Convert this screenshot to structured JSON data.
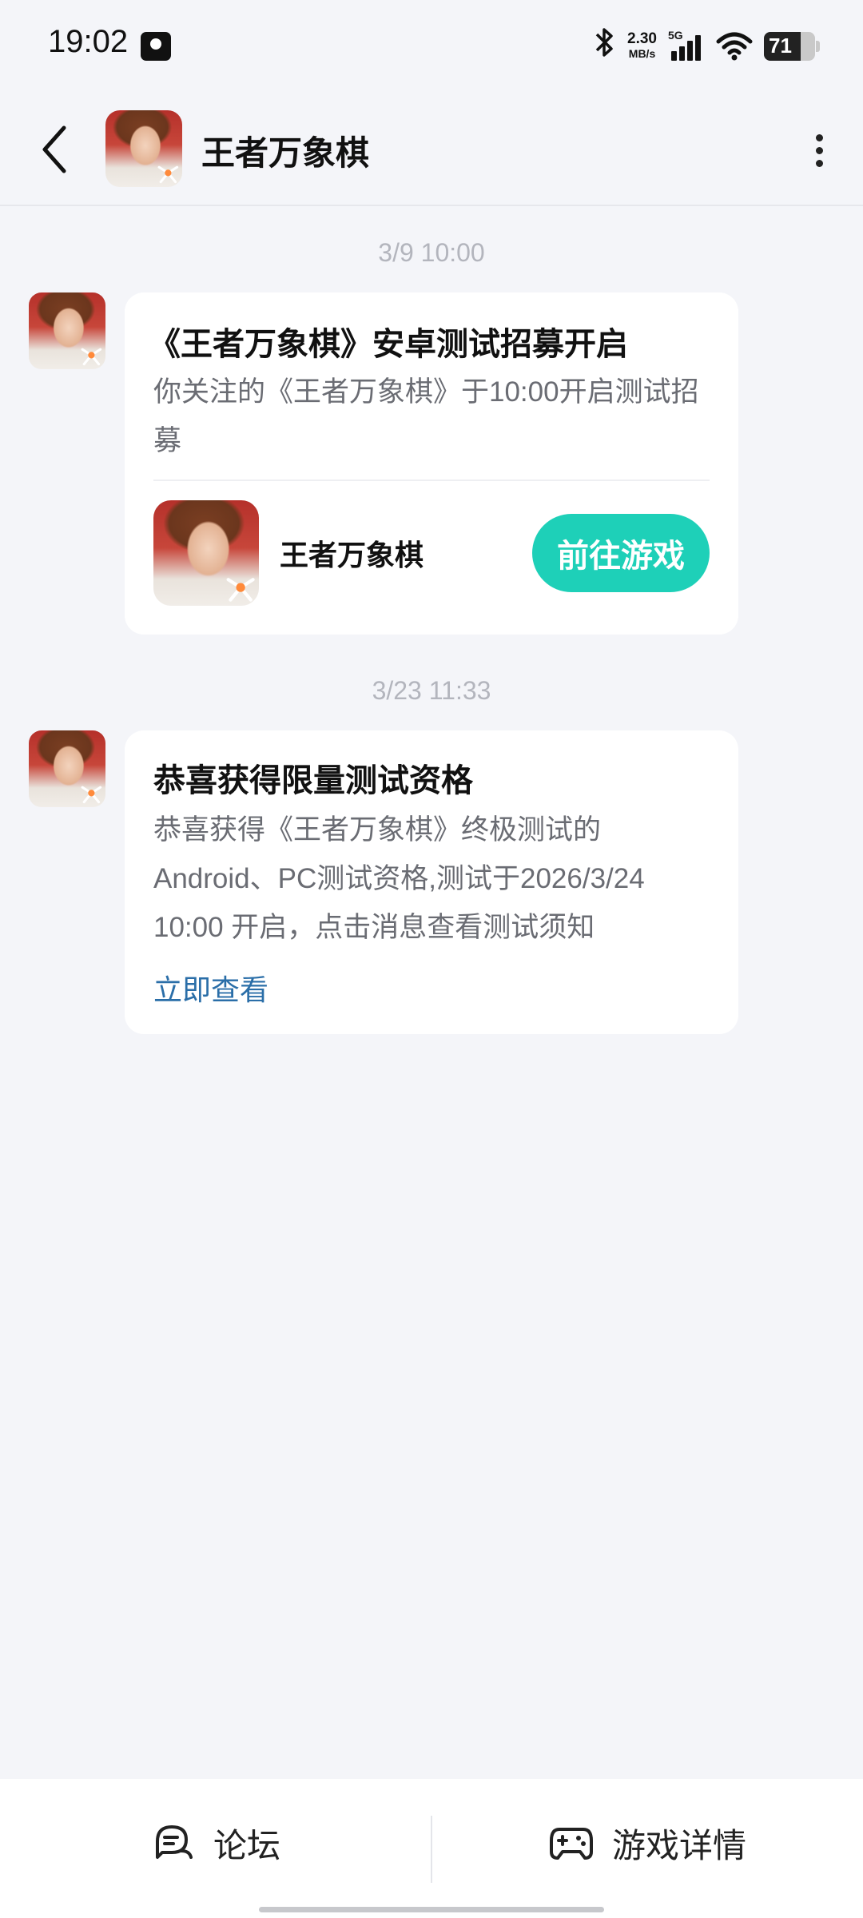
{
  "status_bar": {
    "time": "19:02",
    "net_speed_value": "2.30",
    "net_speed_unit": "MB/s",
    "network_type": "5G",
    "battery_level": "71"
  },
  "header": {
    "title": "王者万象棋",
    "back_icon": "chevron-left-icon",
    "more_icon": "more-vertical-icon"
  },
  "messages": [
    {
      "timestamp": "3/9  10:00",
      "title": "《王者万象棋》安卓测试招募开启",
      "body": "你关注的《王者万象棋》于10:00开启测试招募",
      "game_name": "王者万象棋",
      "button_label": "前往游戏"
    },
    {
      "timestamp": "3/23  11:33",
      "title": "恭喜获得限量测试资格",
      "body": "恭喜获得《王者万象棋》终极测试的Android、PC测试资格,测试于2026/3/24 10:00 开启，点击消息查看测试须知",
      "link_label": "立即查看"
    }
  ],
  "bottom_bar": {
    "forum_label": "论坛",
    "forum_icon": "chat-bubble-icon",
    "details_label": "游戏详情",
    "details_icon": "gamepad-icon"
  },
  "colors": {
    "background": "#f4f5f9",
    "accent": "#1ed0b8",
    "link": "#2a6ea8"
  }
}
